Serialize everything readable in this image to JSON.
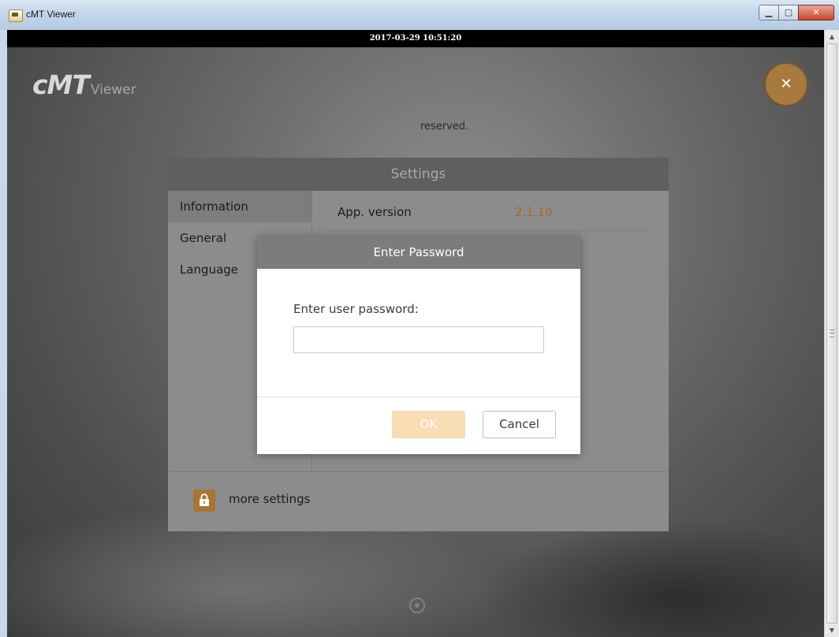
{
  "window": {
    "title": "cMT Viewer",
    "minimize_icon": "minimize-icon",
    "maximize_icon": "maximize-icon",
    "close_icon": "close-icon",
    "minimize_glyph": "▁",
    "maximize_glyph": "▢",
    "close_glyph": "✕"
  },
  "viewer": {
    "timestamp": "2017-03-29 10:51:20",
    "logo_main": "cMT",
    "logo_sub": "Viewer",
    "close_glyph": "✕",
    "accent_color": "#a87a3e"
  },
  "settings": {
    "title": "Settings",
    "sidebar": [
      {
        "label": "Information",
        "active": true
      },
      {
        "label": "General",
        "active": false
      },
      {
        "label": "Language",
        "active": false
      }
    ],
    "info": {
      "app_version_label": "App. version",
      "app_version_value": "2.1.10",
      "rights_text": "reserved."
    },
    "footer": {
      "more_settings_label": "more settings",
      "lock_icon": "lock-icon"
    }
  },
  "password_dialog": {
    "title": "Enter Password",
    "prompt": "Enter user password:",
    "input_value": "",
    "ok_label": "OK",
    "cancel_label": "Cancel"
  },
  "scrollbar": {
    "up_glyph": "▲",
    "down_glyph": "▼"
  }
}
